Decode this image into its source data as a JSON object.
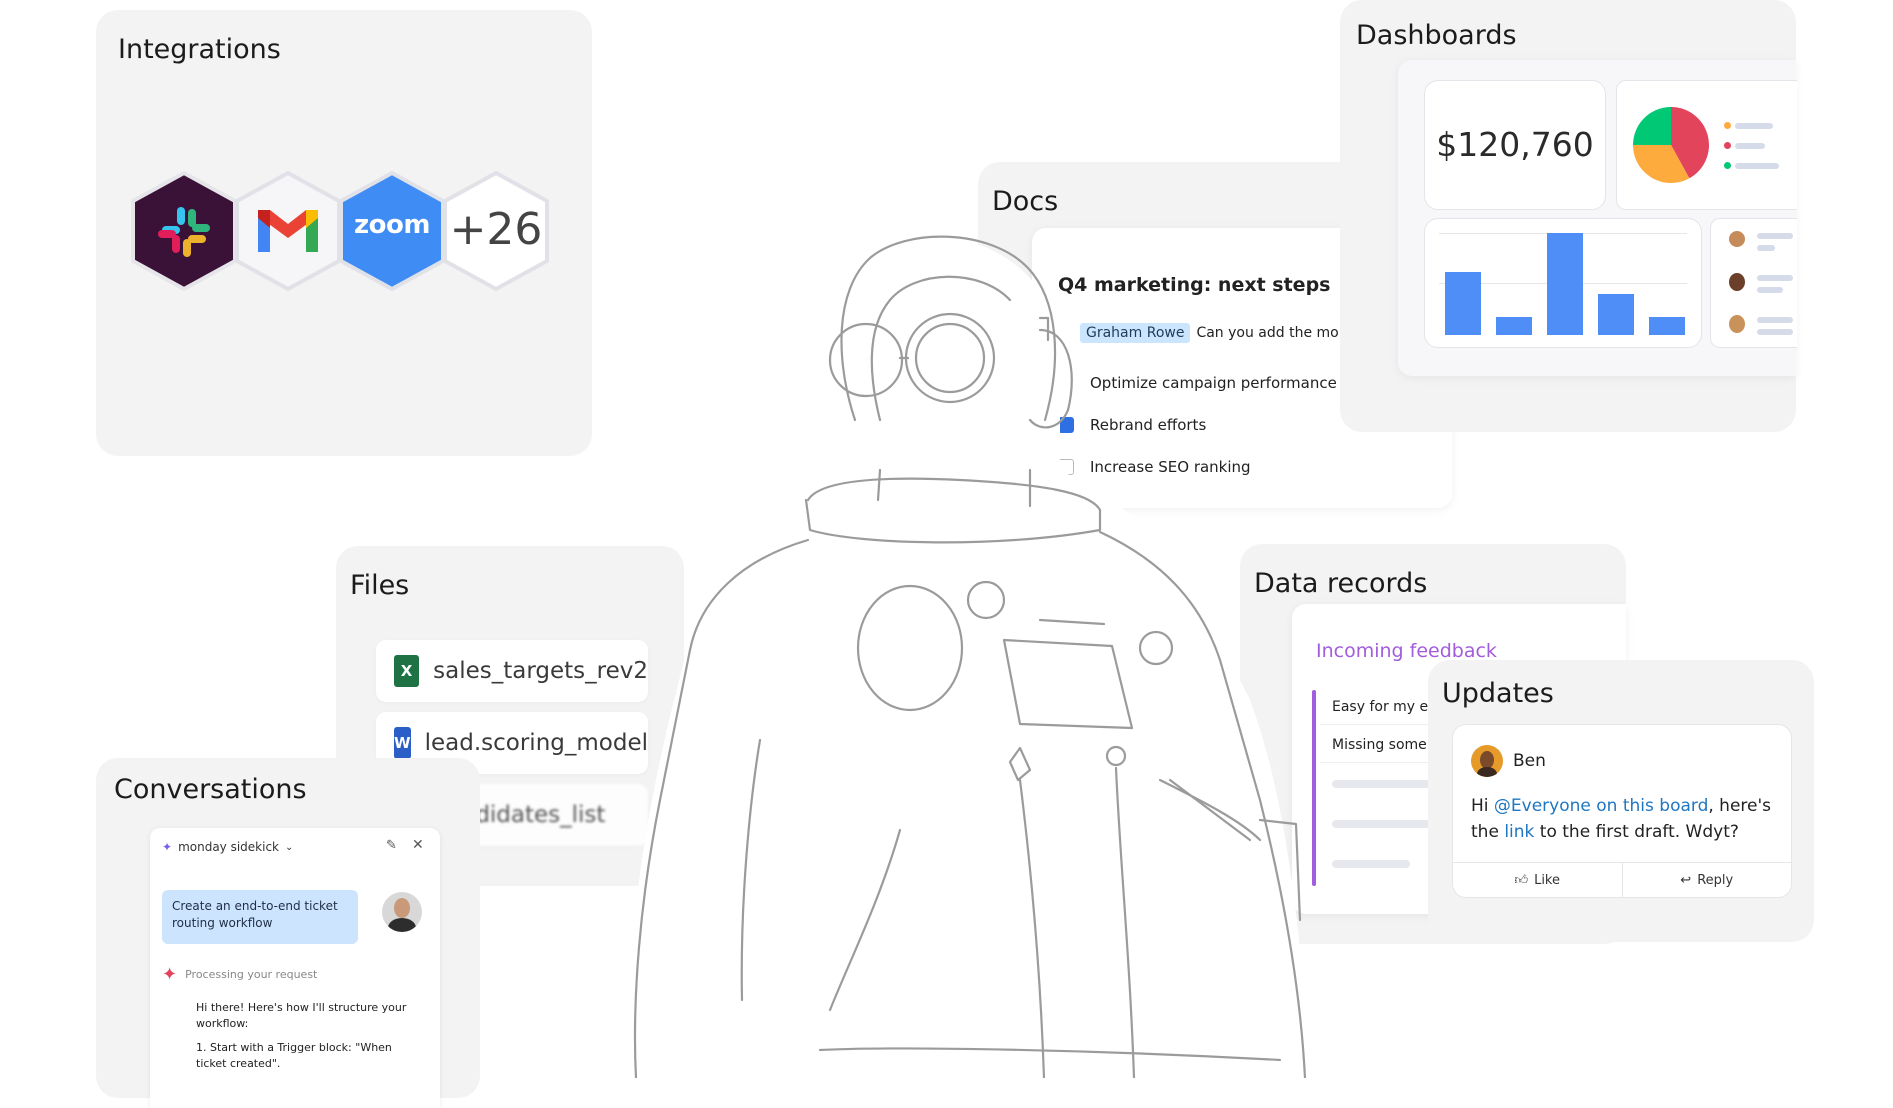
{
  "integrations": {
    "title": "Integrations",
    "zoom_label": "zoom",
    "more_count": "+26",
    "colors": {
      "slack_bg": "#3a1238",
      "zoom_bg": "#3f8cf5"
    }
  },
  "docs": {
    "title": "Docs",
    "heading": "Q4 marketing: next steps",
    "mention_name": "Graham Rowe",
    "mention_text": "Can you add the monthly",
    "items": [
      {
        "label": "Optimize campaign performance"
      },
      {
        "label": "Rebrand efforts"
      },
      {
        "label": "Increase SEO ranking"
      }
    ]
  },
  "dashboards": {
    "title": "Dashboards",
    "kpi_value": "$120,760",
    "bars": [
      0.62,
      0.18,
      1.0,
      0.4,
      0.18
    ],
    "pie": [
      {
        "value": 0.42,
        "color": "#e2445c"
      },
      {
        "value": 0.33,
        "color": "#fdab3d"
      },
      {
        "value": 0.25,
        "color": "#00c875"
      }
    ]
  },
  "files": {
    "title": "Files",
    "items": [
      {
        "name": "sales_targets_rev2",
        "icon": "excel-icon",
        "badge": "X",
        "color": "#1f7244"
      },
      {
        "name": "lead.scoring_model",
        "icon": "word-icon",
        "badge": "W",
        "color": "#2b5fc7"
      },
      {
        "name": "candidates_list",
        "icon": "excel-icon",
        "badge": "X",
        "color": "#1f7244"
      }
    ]
  },
  "data_records": {
    "title": "Data records",
    "board_title": "Incoming feedback",
    "rows": [
      {
        "label": "Easy for my e"
      },
      {
        "label": "Missing some"
      }
    ]
  },
  "updates": {
    "title": "Updates",
    "author": "Ben",
    "msg_prefix": "Hi ",
    "mention": "@Everyone on this board",
    "msg_mid": ", here's the ",
    "link": "link",
    "msg_suffix": " to the first draft. Wdyt?",
    "like_label": "Like",
    "reply_label": "Reply"
  },
  "conversations": {
    "title": "Conversations",
    "assistant_name": "monday sidekick",
    "user_message": "Create an end-to-end ticket routing workflow",
    "status": "Processing your request",
    "reply_line1": "Hi there! Here's how I'll structure your workflow:",
    "reply_line2": "1. Start with a Trigger block: \"When ticket created\"."
  }
}
